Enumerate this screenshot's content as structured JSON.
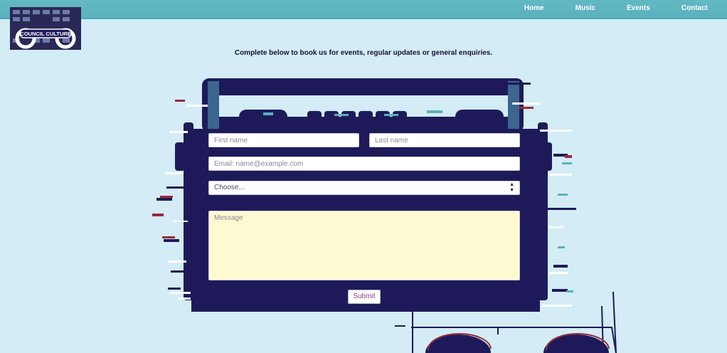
{
  "nav": {
    "links": [
      "Home",
      "Music",
      "Events",
      "Contact"
    ]
  },
  "logo": {
    "text": "COUNCIL CULTURE",
    "icon": "council-culture-logo"
  },
  "intro": "Complete below to book us for events, regular updates or general enquiries.",
  "form": {
    "first_name_placeholder": "First name",
    "last_name_placeholder": "Last name",
    "email_placeholder": "Email: name@example.com",
    "select_value": "Choose...",
    "message_placeholder": "Message",
    "submit_label": "Submit"
  },
  "colors": {
    "navbar": "#5ab1bf",
    "background": "#d3ecf5",
    "panel": "#1e1a5a",
    "message_bg": "#fdfad2",
    "accent_red": "#9a2a3a",
    "accent_teal": "#55bcc7"
  }
}
